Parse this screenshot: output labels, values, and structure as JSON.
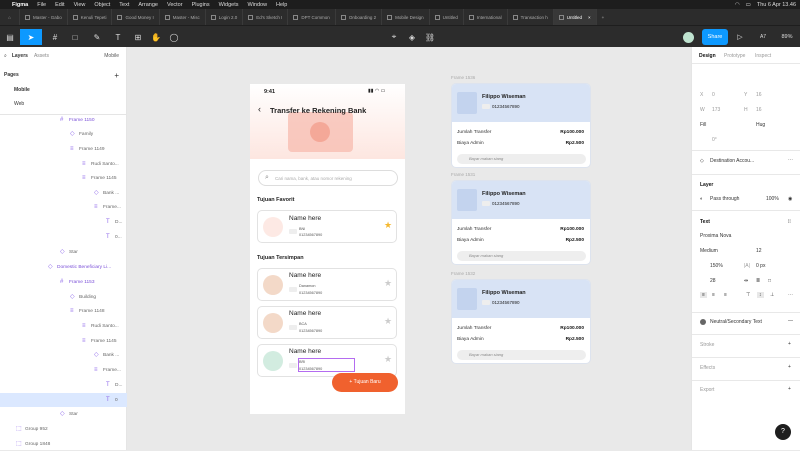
{
  "menubar": {
    "app": "Figma",
    "items": [
      "File",
      "Edit",
      "View",
      "Object",
      "Text",
      "Arrange",
      "Vector",
      "Plugins",
      "Widgets",
      "Window",
      "Help"
    ],
    "clock": "Thu 6 Apr 13.46"
  },
  "tabs": [
    "Master - Gabo",
    "Kenuli Tepeti",
    "Good Money I",
    "Master - Misc",
    "Login 2.0",
    "Ed's Sketch I",
    "DPT Common",
    "Onboarding 2",
    "Mobile Design",
    "Untitled",
    "International",
    "Transaction h",
    "Untitled"
  ],
  "toolbar": {
    "share": "Share",
    "zoom": "89%"
  },
  "leftpanel": {
    "tab_layers": "Layers",
    "tab_assets": "Assets",
    "page_select": "Mobile",
    "pages_title": "Pages",
    "pages": [
      "Mobile",
      "Web"
    ],
    "layers": [
      "Frame 1150",
      "Family",
      "Frame 1149",
      "Rudi Santo...",
      "Frame 1145",
      "Bank ...",
      "Frame...",
      "D...",
      "0...",
      "Star",
      "Domestic Beneficiary Li...",
      "Frame 1153",
      "Building",
      "Frame 1148",
      "Rudi Santo...",
      "Frame 1145",
      "Bank ...",
      "Frame...",
      "D...",
      "0",
      "Star",
      "Group 952",
      "Group 1848"
    ]
  },
  "phone": {
    "time": "9:41",
    "title": "Transfer ke Rekening Bank",
    "search_placeholder": "Cari nama, bank, atau nomor rekening",
    "favorites_title": "Tujuan Favorit",
    "saved_title": "Tujuan Tersimpan",
    "favorite": {
      "name": "Name here",
      "bank": "BNI",
      "account": "01234567890"
    },
    "saved": [
      {
        "name": "Name here",
        "bank": "Danamon",
        "account": "01234567890"
      },
      {
        "name": "Name here",
        "bank": "BCA",
        "account": "01234567890"
      },
      {
        "name": "Name here",
        "bank": "BRI",
        "account": "01234567890"
      }
    ],
    "fab": "+ Tujuan Baru"
  },
  "frames": [
    {
      "label": "Frame 1536",
      "name": "Filippo Wiseman",
      "account": "01234567890",
      "amount_label": "Jumlah Transfer",
      "amount": "Rp100.000",
      "fee_label": "Biaya Admin",
      "fee": "Rp2.500",
      "note": "Bayar makan siang"
    },
    {
      "label": "Frame 1531",
      "name": "Filippo Wiseman",
      "account": "01234567890",
      "amount_label": "Jumlah Transfer",
      "amount": "Rp100.000",
      "fee_label": "Biaya Admin",
      "fee": "Rp2.500",
      "note": "Bayar makan siang"
    },
    {
      "label": "Frame 1532",
      "name": "Filippo Wiseman",
      "account": "01234567890",
      "amount_label": "Jumlah Transfer",
      "amount": "Rp100.000",
      "fee_label": "Biaya Admin",
      "fee": "Rp2.500",
      "note": "Bayar makan siang"
    }
  ],
  "rightpanel": {
    "tabs": [
      "Design",
      "Prototype",
      "Inspect"
    ],
    "x": "X",
    "x_val": "0",
    "y": "Y",
    "y_val": "16",
    "w": "W",
    "w_val": "173",
    "h": "H",
    "h_val": "16",
    "fill": "Fill",
    "hug": "Hug",
    "rot": "0°",
    "component": "Destination Accou...",
    "layer_title": "Layer",
    "blend": "Pass through",
    "opacity": "100%",
    "text_title": "Text",
    "font": "Proxima Nova",
    "weight": "Medium",
    "size": "12",
    "line_height": "150%",
    "letter": "0 px",
    "para": "28",
    "style": "Neutral/Secondary Text",
    "stroke": "Stroke",
    "effects": "Effects",
    "export": "Export",
    "help": "?"
  },
  "colors": {
    "accent": "#0d99ff",
    "fab": "#f0612e",
    "purple": "#8f69ea"
  }
}
